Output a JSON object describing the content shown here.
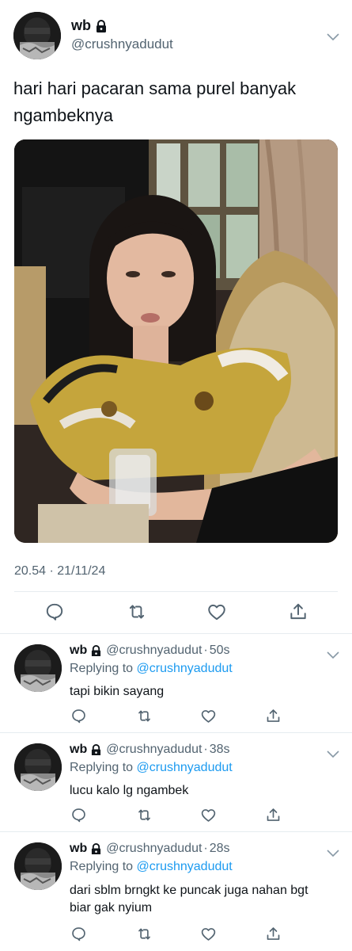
{
  "main_tweet": {
    "display_name": "wb",
    "handle": "@crushnyadudut",
    "text": "hari hari pacaran sama purel banyak ngambeknya",
    "timestamp": "20.54 · 21/11/24",
    "icons": [
      "lock-icon",
      "chevron-down-icon",
      "reply-icon",
      "retweet-icon",
      "like-icon",
      "share-icon"
    ]
  },
  "replies": [
    {
      "display_name": "wb",
      "handle": "@crushnyadudut",
      "dot": "·",
      "time": "50s",
      "replying_prefix": "Replying to ",
      "replying_to": "@crushnyadudut",
      "text": "tapi bikin sayang"
    },
    {
      "display_name": "wb",
      "handle": "@crushnyadudut",
      "dot": "·",
      "time": "38s",
      "replying_prefix": "Replying to ",
      "replying_to": "@crushnyadudut",
      "text": "lucu kalo lg ngambek"
    },
    {
      "display_name": "wb",
      "handle": "@crushnyadudut",
      "dot": "·",
      "time": "28s",
      "replying_prefix": "Replying to ",
      "replying_to": "@crushnyadudut",
      "text": "dari sblm brngkt ke puncak juga nahan bgt biar gak nyium"
    }
  ],
  "colors": {
    "text": "#0f1419",
    "secondary": "#536471",
    "accent": "#1d9bf0",
    "divider": "#e6ecf0"
  }
}
